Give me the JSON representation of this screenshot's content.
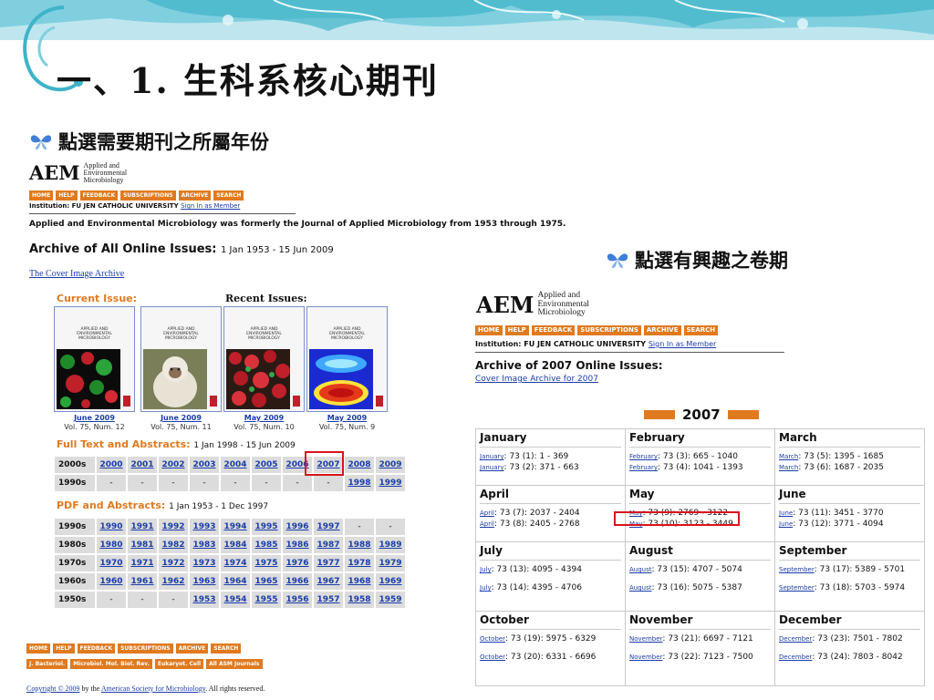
{
  "slide": {
    "title": "一、1. 生科系核心期刊",
    "bullet1": "點選需要期刊之所屬年份",
    "bullet2": "點選有興趣之卷期"
  },
  "left_page": {
    "logo_big": "AEM",
    "logo_lines": [
      "Applied and",
      "Environmental",
      "Microbiology"
    ],
    "nav": [
      "HOME",
      "HELP",
      "FEEDBACK",
      "SUBSCRIPTIONS",
      "ARCHIVE",
      "SEARCH"
    ],
    "institution_label": "Institution: FU JEN CATHOLIC UNIVERSITY",
    "sign_in": "Sign In as Member",
    "note": "Applied and Environmental Microbiology was formerly the Journal of Applied Microbiology from 1953 through 1975.",
    "archive_title": "Archive of All Online Issues:",
    "archive_range": "1 Jan 1953 - 15 Jun 2009",
    "cover_archive_link": "The Cover Image Archive",
    "current_issue_label": "Current Issue:",
    "recent_issues_label": "Recent Issues:",
    "cover_title_lines": [
      "APPLIED AND",
      "ENVIRONMENTAL",
      "MICROBIOLOGY"
    ],
    "covers": [
      {
        "date": "June 2009",
        "vol": "Vol. 75, Num. 12"
      },
      {
        "date": "June 2009",
        "vol": "Vol. 75, Num. 11"
      },
      {
        "date": "May 2009",
        "vol": "Vol. 75, Num. 10"
      },
      {
        "date": "May 2009",
        "vol": "Vol. 75, Num. 9"
      }
    ],
    "full_text_label": "Full Text and Abstracts:",
    "full_text_range": "1 Jan 1998 - 15 Jun 2009",
    "full_text_rows": [
      {
        "decade": "2000s",
        "years": [
          "2000",
          "2001",
          "2002",
          "2003",
          "2004",
          "2005",
          "2006",
          "2007",
          "2008",
          "2009"
        ]
      },
      {
        "decade": "1990s",
        "years": [
          "-",
          "-",
          "-",
          "-",
          "-",
          "-",
          "-",
          "-",
          "1998",
          "1999"
        ]
      }
    ],
    "pdf_label": "PDF and Abstracts:",
    "pdf_range": "1 Jan 1953 - 1 Dec 1997",
    "pdf_rows": [
      {
        "decade": "1990s",
        "years": [
          "1990",
          "1991",
          "1992",
          "1993",
          "1994",
          "1995",
          "1996",
          "1997",
          "-",
          "-"
        ]
      },
      {
        "decade": "1980s",
        "years": [
          "1980",
          "1981",
          "1982",
          "1983",
          "1984",
          "1985",
          "1986",
          "1987",
          "1988",
          "1989"
        ]
      },
      {
        "decade": "1970s",
        "years": [
          "1970",
          "1971",
          "1972",
          "1973",
          "1974",
          "1975",
          "1976",
          "1977",
          "1978",
          "1979"
        ]
      },
      {
        "decade": "1960s",
        "years": [
          "1960",
          "1961",
          "1962",
          "1963",
          "1964",
          "1965",
          "1966",
          "1967",
          "1968",
          "1969"
        ]
      },
      {
        "decade": "1950s",
        "years": [
          "-",
          "-",
          "-",
          "1953",
          "1954",
          "1955",
          "1956",
          "1957",
          "1958",
          "1959"
        ]
      }
    ],
    "footer_nav": [
      "HOME",
      "HELP",
      "FEEDBACK",
      "SUBSCRIPTIONS",
      "ARCHIVE",
      "SEARCH"
    ],
    "footer_journals": [
      "J. Bacteriol.",
      "Microbiol. Mol. Biol. Rev.",
      "Eukaryot. Cell",
      "All ASM Journals"
    ],
    "copyright_prefix": "Copyright © 2009",
    "copyright_by": " by the ",
    "copyright_org": "American Society for Microbiology",
    "copyright_suffix": ". All rights reserved."
  },
  "right_page": {
    "logo_big": "AEM",
    "logo_lines": [
      "Applied and",
      "Environmental",
      "Microbiology"
    ],
    "nav": [
      "HOME",
      "HELP",
      "FEEDBACK",
      "SUBSCRIPTIONS",
      "ARCHIVE",
      "SEARCH"
    ],
    "institution_label": "Institution: FU JEN CATHOLIC UNIVERSITY",
    "sign_in": "Sign In as Member",
    "archive_title": "Archive of 2007 Online Issues:",
    "cover_archive_link": "Cover Image Archive for 2007",
    "year": "2007",
    "months": [
      {
        "name": "January",
        "issues": [
          {
            "m": "January",
            "t": ": 73 (1): 1 - 369"
          },
          {
            "m": "January",
            "t": ": 73 (2): 371 - 663"
          }
        ]
      },
      {
        "name": "February",
        "issues": [
          {
            "m": "February",
            "t": ": 73 (3): 665 - 1040"
          },
          {
            "m": "February",
            "t": ": 73 (4): 1041 - 1393"
          }
        ]
      },
      {
        "name": "March",
        "issues": [
          {
            "m": "March",
            "t": ": 73 (5): 1395 - 1685"
          },
          {
            "m": "March",
            "t": ": 73 (6): 1687 - 2035"
          }
        ]
      },
      {
        "name": "April",
        "issues": [
          {
            "m": "April",
            "t": ": 73 (7): 2037 - 2404"
          },
          {
            "m": "April",
            "t": ": 73 (8): 2405 - 2768"
          }
        ]
      },
      {
        "name": "May",
        "issues": [
          {
            "m": "May",
            "t": ": 73 (9): 2769 - 3122"
          },
          {
            "m": "May",
            "t": ": 73 (10): 3123 - 3449"
          }
        ]
      },
      {
        "name": "June",
        "issues": [
          {
            "m": "June",
            "t": ": 73 (11): 3451 - 3770"
          },
          {
            "m": "June",
            "t": ": 73 (12): 3771 - 4094"
          }
        ]
      },
      {
        "name": "July",
        "issues": [
          {
            "m": "July",
            "t": ": 73 (13): 4095 - 4394"
          },
          {
            "m": "July",
            "t": ": 73 (14): 4395 - 4706"
          }
        ]
      },
      {
        "name": "August",
        "issues": [
          {
            "m": "August",
            "t": ": 73 (15): 4707 - 5074"
          },
          {
            "m": "August",
            "t": ": 73 (16): 5075 - 5387"
          }
        ]
      },
      {
        "name": "September",
        "issues": [
          {
            "m": "September",
            "t": ": 73 (17): 5389 - 5701"
          },
          {
            "m": "September",
            "t": ": 73 (18): 5703 - 5974"
          }
        ]
      },
      {
        "name": "October",
        "issues": [
          {
            "m": "October",
            "t": ": 73 (19): 5975 - 6329"
          },
          {
            "m": "October",
            "t": ": 73 (20): 6331 - 6696"
          }
        ]
      },
      {
        "name": "November",
        "issues": [
          {
            "m": "November",
            "t": ": 73 (21): 6697 - 7121"
          },
          {
            "m": "November",
            "t": ": 73 (22): 7123 - 7500"
          }
        ]
      },
      {
        "name": "December",
        "issues": [
          {
            "m": "December",
            "t": ": 73 (23): 7501 - 7802"
          },
          {
            "m": "December",
            "t": ": 73 (24): 7803 - 8042"
          }
        ]
      }
    ]
  },
  "colors": {
    "accent_orange": "#e07a1f",
    "link_blue": "#1a3da8",
    "highlight_red": "#d9141d",
    "banner_teal": "#3fb3c7"
  }
}
